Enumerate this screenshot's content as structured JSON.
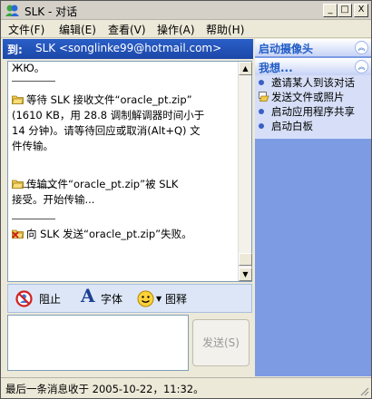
{
  "window": {
    "title": "SLK - 对话",
    "min_label": "_",
    "max_label": "□",
    "close_label": "X"
  },
  "menu": [
    {
      "label": "文件(F)"
    },
    {
      "label": "编辑(E)"
    },
    {
      "label": "查看(V)"
    },
    {
      "label": "操作(A)"
    },
    {
      "label": "帮助(H)"
    }
  ],
  "to_bar": {
    "label": "到:",
    "value": "SLK <songlinke99@hotmail.com>"
  },
  "conversation": {
    "partial_top": "ЖЮ。",
    "messages": [
      {
        "lines": [
          "等待 SLK 接收文件“oracle_pt.zip”",
          "(1610 KB，用 28.8 调制解调器时间小于",
          "14 分钟)。请等待回应或取消(Alt+Q) 文",
          "件传输。"
        ],
        "icon": "folder-icon"
      },
      {
        "lines": [
          "传输文件“oracle_pt.zip”被 SLK",
          "接受。开始传输..."
        ],
        "icon": "folder-icon"
      },
      {
        "lines": [
          "向 SLK 发送“oracle_pt.zip”失败。"
        ],
        "icon": "folder-error-icon"
      }
    ]
  },
  "toolbar": {
    "block_label": "阻止",
    "font_label": "字体",
    "emoticon_label": "图释"
  },
  "input": {
    "value": "",
    "send_label": "发送(S)"
  },
  "side_panel": {
    "webcam_header": "启动摄像头",
    "ideas_header": "我想...",
    "items": [
      {
        "label": "邀请某人到该对话",
        "icon": "dot"
      },
      {
        "label": "发送文件或照片",
        "icon": "send-file-icon"
      },
      {
        "label": "启动应用程序共享",
        "icon": "dot"
      },
      {
        "label": "启动白板",
        "icon": "dot"
      }
    ]
  },
  "status": {
    "text": "最后一条消息收于 2005-10-22，11:32。"
  },
  "colors": {
    "to_bar": "#1c47a8",
    "side_panel": "#7c9be3",
    "error_text": "#000000",
    "send_disabled": "#999999"
  }
}
